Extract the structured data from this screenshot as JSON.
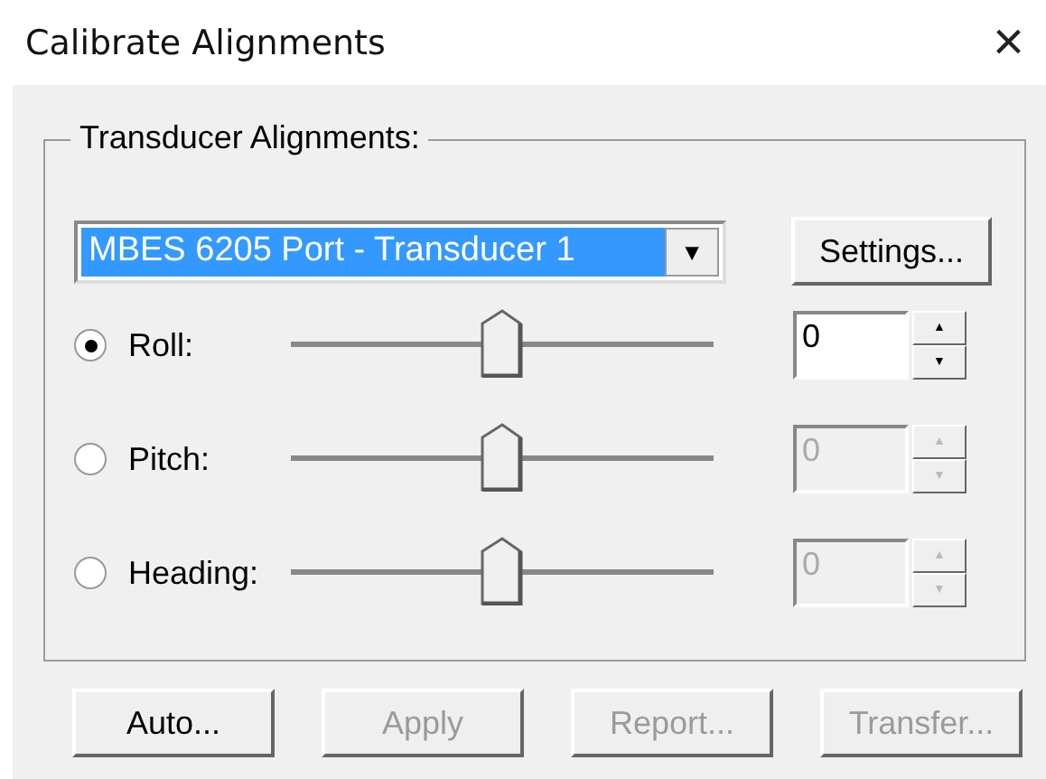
{
  "window": {
    "title": "Calibrate Alignments",
    "close": "×"
  },
  "group": {
    "title": "Transducer Alignments:",
    "combo": {
      "value": "MBES 6205 Port - Transducer 1",
      "arrow": "▼"
    },
    "settings": "Settings...",
    "axes": [
      {
        "label": "Roll:",
        "selected": true,
        "level": 0.5,
        "value": "0",
        "disabled": false,
        "up": "▲",
        "down": "▼"
      },
      {
        "label": "Pitch:",
        "selected": false,
        "level": 0.5,
        "value": "0",
        "disabled": true,
        "up": "▲",
        "down": "▼"
      },
      {
        "label": "Heading:",
        "selected": false,
        "level": 0.5,
        "value": "0",
        "disabled": true,
        "up": "▲",
        "down": "▼"
      }
    ]
  },
  "buttons": [
    {
      "label": "Auto...",
      "disabled": false
    },
    {
      "label": "Apply",
      "disabled": true
    },
    {
      "label": "Report...",
      "disabled": true
    },
    {
      "label": "Transfer...",
      "disabled": true
    }
  ]
}
